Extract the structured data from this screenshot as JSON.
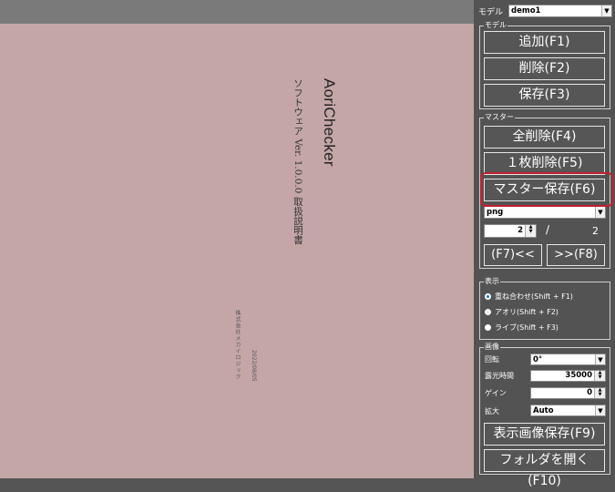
{
  "document": {
    "title": "AoriChecker",
    "subtitle": "ソフトウェア Ver. 1.0.0.0  取扱説明書",
    "company": "株式会社メカイロジック",
    "date": "2022/08/05"
  },
  "panel": {
    "model_label": "モデル",
    "model_value": "demo1",
    "model_group": {
      "title": "モデル",
      "add": "追加(F1)",
      "delete": "削除(F2)",
      "save": "保存(F3)"
    },
    "master_group": {
      "title": "マスター",
      "delete_all": "全削除(F4)",
      "delete_one": "１枚削除(F5)",
      "save_master": "マスター保存(F6)",
      "format": "png",
      "page_current": "2",
      "page_sep": "/",
      "page_total": "2",
      "prev": "(F7)<<",
      "next": ">>(F8)"
    },
    "display_group": {
      "title": "表示",
      "options": [
        {
          "label": "重ね合わせ(Shift + F1)",
          "selected": true
        },
        {
          "label": "アオリ(Shift + F2)",
          "selected": false
        },
        {
          "label": "ライブ(Shift + F3)",
          "selected": false
        }
      ]
    },
    "image_group": {
      "title": "画像",
      "rotation_label": "回転",
      "rotation_value": "0°",
      "exposure_label": "露光時間",
      "exposure_value": "35000",
      "gain_label": "ゲイン",
      "gain_value": "0",
      "zoom_label": "拡大",
      "zoom_value": "Auto",
      "save_display": "表示画像保存(F9)",
      "open_folder": "フォルダを開く(F10)"
    }
  }
}
